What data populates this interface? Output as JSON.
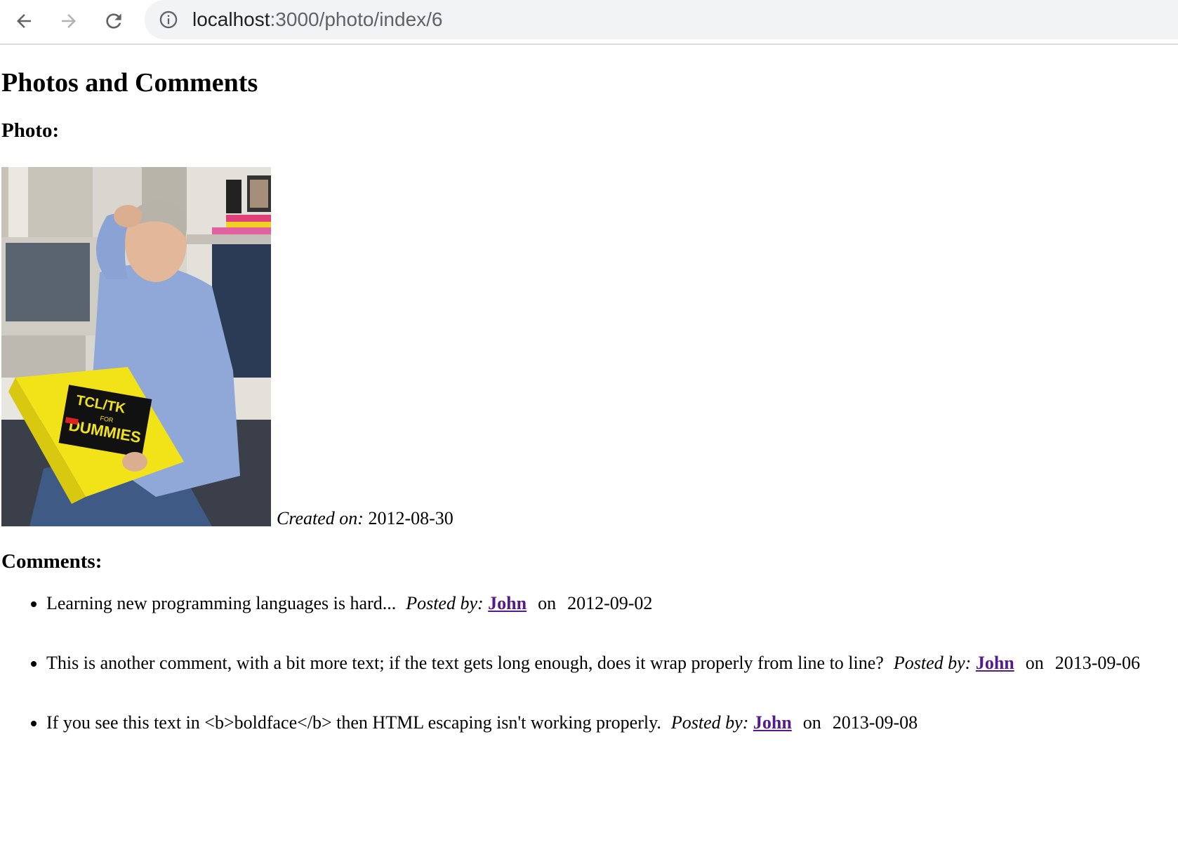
{
  "browser": {
    "url_host": "localhost",
    "url_path": ":3000/photo/index/6"
  },
  "page": {
    "title": "Photos and Comments",
    "photo_heading": "Photo:",
    "created_label": "Created on:",
    "created_date": "2012-08-30",
    "comments_heading": "Comments:",
    "posted_label": "Posted by:",
    "on_label": "on"
  },
  "photo": {
    "book_title": "TCL/TK",
    "book_for": "FOR",
    "book_dummies": "DUMMIES"
  },
  "comments": [
    {
      "text": "Learning new programming languages is hard...",
      "author": "John",
      "date": "2012-09-02"
    },
    {
      "text": "This is another comment, with a bit more text; if the text gets long enough, does it wrap properly from line to line?",
      "author": "John",
      "date": "2013-09-06"
    },
    {
      "text": "If you see this text in <b>boldface</b> then HTML escaping isn't working properly.",
      "author": "John",
      "date": "2013-09-08"
    }
  ]
}
